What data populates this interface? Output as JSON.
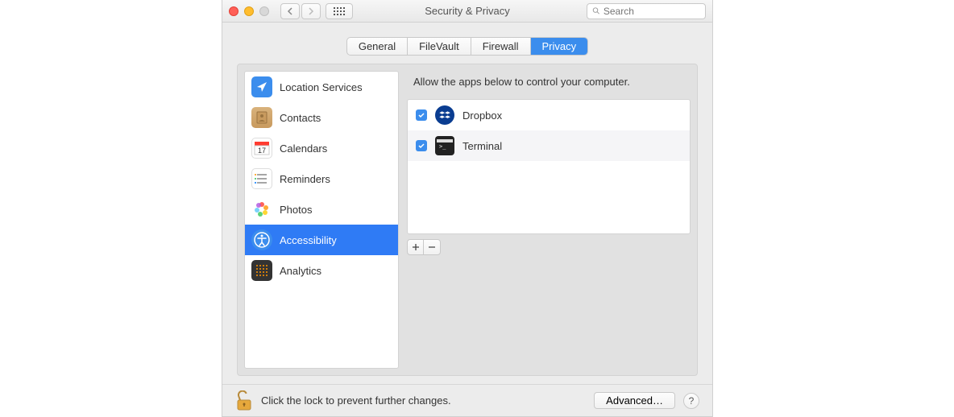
{
  "window": {
    "title": "Security & Privacy"
  },
  "search": {
    "placeholder": "Search"
  },
  "tabs": [
    {
      "id": "general",
      "label": "General",
      "selected": false
    },
    {
      "id": "filevault",
      "label": "FileVault",
      "selected": false
    },
    {
      "id": "firewall",
      "label": "Firewall",
      "selected": false
    },
    {
      "id": "privacy",
      "label": "Privacy",
      "selected": true
    }
  ],
  "sidebar": {
    "items": [
      {
        "id": "location",
        "label": "Location Services",
        "icon": "location-arrow-icon",
        "selected": false
      },
      {
        "id": "contacts",
        "label": "Contacts",
        "icon": "contacts-book-icon",
        "selected": false
      },
      {
        "id": "calendars",
        "label": "Calendars",
        "icon": "calendar-icon",
        "selected": false
      },
      {
        "id": "reminders",
        "label": "Reminders",
        "icon": "reminders-icon",
        "selected": false
      },
      {
        "id": "photos",
        "label": "Photos",
        "icon": "photos-flower-icon",
        "selected": false
      },
      {
        "id": "accessibility",
        "label": "Accessibility",
        "icon": "accessibility-icon",
        "selected": true
      },
      {
        "id": "analytics",
        "label": "Analytics",
        "icon": "analytics-grid-icon",
        "selected": false
      }
    ]
  },
  "panel": {
    "prompt": "Allow the apps below to control your computer.",
    "apps": [
      {
        "id": "dropbox",
        "label": "Dropbox",
        "checked": true,
        "icon": "dropbox-icon"
      },
      {
        "id": "terminal",
        "label": "Terminal",
        "checked": true,
        "icon": "terminal-icon"
      }
    ]
  },
  "footer": {
    "lock_text": "Click the lock to prevent further changes.",
    "advanced_label": "Advanced…"
  }
}
